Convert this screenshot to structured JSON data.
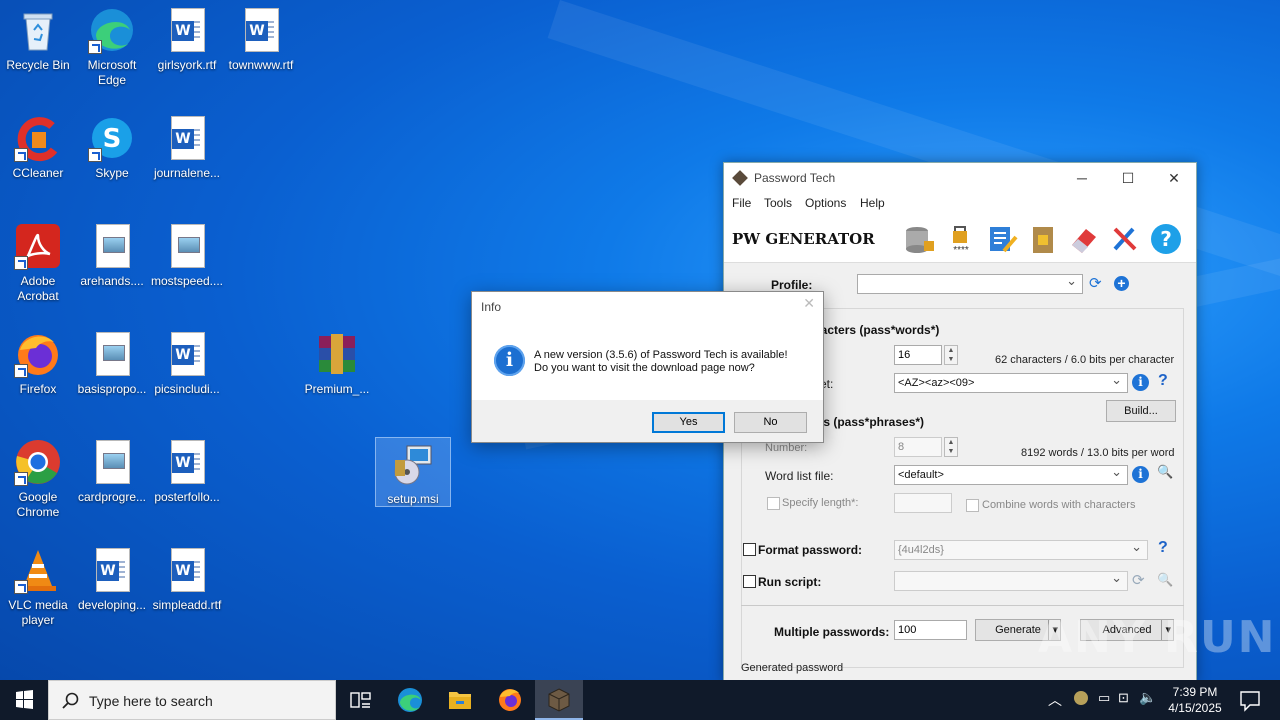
{
  "desktop": {
    "icons": [
      {
        "label": "Recycle Bin"
      },
      {
        "label": "Microsoft Edge"
      },
      {
        "label": "girlsyork.rtf"
      },
      {
        "label": "townwww.rtf"
      },
      {
        "label": "CCleaner"
      },
      {
        "label": "Skype"
      },
      {
        "label": "journalene..."
      },
      {
        "label": "Adobe Acrobat"
      },
      {
        "label": "arehands...."
      },
      {
        "label": "mostspeed...."
      },
      {
        "label": "Firefox"
      },
      {
        "label": "basispropo..."
      },
      {
        "label": "picsincludi..."
      },
      {
        "label": "Premium_..."
      },
      {
        "label": "Google Chrome"
      },
      {
        "label": "cardprogre..."
      },
      {
        "label": "posterfollo..."
      },
      {
        "label": "setup.msi"
      },
      {
        "label": "VLC media player"
      },
      {
        "label": "developing..."
      },
      {
        "label": "simpleadd.rtf"
      }
    ]
  },
  "pwt": {
    "title": "Password Tech",
    "menu": [
      "File",
      "Tools",
      "Options",
      "Help"
    ],
    "header_title": "PW GENERATOR",
    "profile_label": "Profile:",
    "profile_value": "",
    "chars_section": "racters (pass*words*)",
    "length_value": "16",
    "chars_info": "62 characters / 6.0 bits per character",
    "charset_label": "et:",
    "charset_value": "<AZ><az><09>",
    "build_label": "Build...",
    "words_section": "ds (pass*phrases*)",
    "number_label": "Number:",
    "number_value": "8",
    "words_info": "8192 words / 13.0 bits per word",
    "wordlist_label": "Word list file:",
    "wordlist_value": "<default>",
    "specify_length_label": "Specify length*:",
    "combine_label": "Combine words with characters",
    "format_label": "Format password:",
    "format_value": "{4u4l2ds}",
    "script_label": "Run script:",
    "multiple_label": "Multiple passwords:",
    "multiple_value": "100",
    "generate_label": "Generate",
    "advanced_label": "Advanced",
    "generated_label": "Generated password"
  },
  "dialog": {
    "title": "Info",
    "line1": "A new version (3.5.6) of Password Tech is available!",
    "line2": "Do you want to visit the download page now?",
    "yes": "Yes",
    "no": "No"
  },
  "taskbar": {
    "search_placeholder": "Type here to search",
    "time": "7:39 PM",
    "date": "4/15/2025"
  },
  "watermark": "ANY RUN"
}
